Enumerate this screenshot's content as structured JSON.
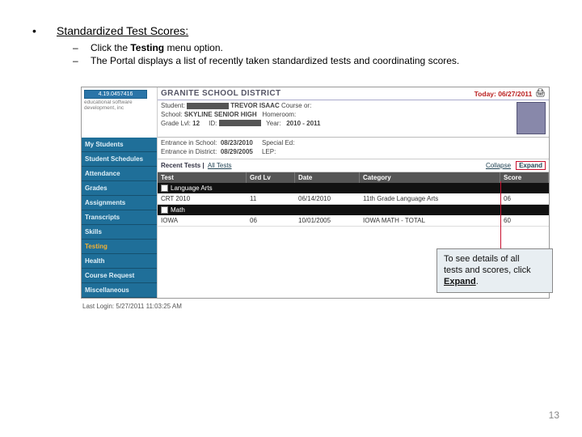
{
  "doc": {
    "section_title": "Standardized Test Scores:",
    "sub1_prefix": "Click the ",
    "sub1_bold": "Testing",
    "sub1_suffix": " menu option.",
    "sub2": "The Portal displays a list of recently taken standardized tests and coordinating scores.",
    "page_number": "13"
  },
  "callout": {
    "line1": "To see details of all",
    "line2": "tests and scores, click",
    "word": "Expand",
    "period": "."
  },
  "portal": {
    "logo_text": "4.19.0457416",
    "logo_sub": "educational software development, inc",
    "district": "GRANITE SCHOOL DISTRICT",
    "today_label": "Today: 06/27/2011",
    "student_label": "Student:",
    "student_value": "TREVOR ISAAC",
    "course_label": "Course or:",
    "school_label": "School:",
    "school_value": "SKYLINE SENIOR HIGH",
    "homeroom_label": "Homeroom:",
    "grade_label": "Grade Lvl:",
    "grade_value": "12",
    "id_label": "ID:",
    "year_label": "Year:",
    "year_value": "2010 - 2011",
    "entr_school_label": "Entrance in School:",
    "entr_school_value": "08/23/2010",
    "entr_dist_label": "Entrance in District:",
    "entr_dist_value": "08/29/2005",
    "special_ed_label": "Special Ed:",
    "lep_label": "LEP:",
    "recent_label": "Recent Tests |",
    "all_tests": "All Tests",
    "collapse": "Collapse",
    "expand": "Expand",
    "last_login": "Last Login: 5/27/2011 11:03:25 AM"
  },
  "nav": {
    "items": [
      "My Students",
      "Student Schedules",
      "Attendance",
      "Grades",
      "Assignments",
      "Transcripts",
      "Skills",
      "Testing",
      "Health",
      "Course Request",
      "Miscellaneous"
    ]
  },
  "table": {
    "headers": {
      "test": "Test",
      "grd": "Grd Lv",
      "date": "Date",
      "cat": "Category",
      "score": "Score"
    },
    "sections": [
      {
        "name": "Language Arts",
        "rows": [
          {
            "test": "CRT 2010",
            "grd": "11",
            "date": "06/14/2010",
            "cat": "11th Grade Language Arts",
            "score": "06"
          }
        ]
      },
      {
        "name": "Math",
        "rows": [
          {
            "test": "IOWA",
            "grd": "06",
            "date": "10/01/2005",
            "cat": "IOWA MATH - TOTAL",
            "score": "60"
          }
        ]
      }
    ]
  }
}
